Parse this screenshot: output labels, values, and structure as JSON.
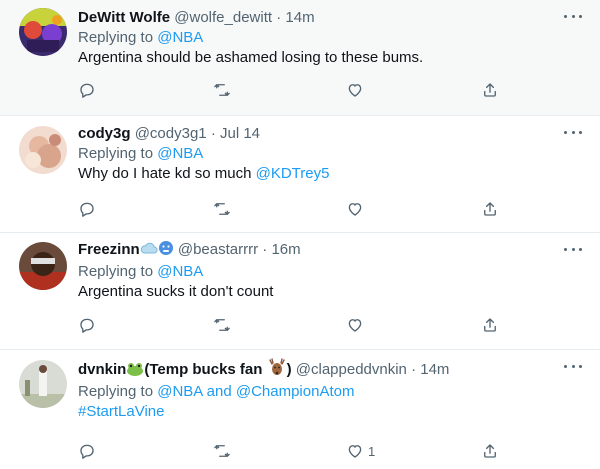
{
  "tweets": [
    {
      "name": "DeWitt Wolfe",
      "handle": "@wolfe_dewitt",
      "sep": "·",
      "time": "14m",
      "replying_prefix": "Replying to ",
      "replying_to": "@NBA",
      "text": "Argentina should be ashamed losing to these bums."
    },
    {
      "name": "cody3g",
      "handle": "@cody3g1",
      "sep": "·",
      "time": "Jul 14",
      "replying_prefix": "Replying to ",
      "replying_to": "@NBA",
      "text": "Why do I hate kd so much ",
      "mention": "@KDTrey5"
    },
    {
      "name": "Freezinn",
      "handle": "@beastarrrr",
      "sep": "·",
      "time": "16m",
      "replying_prefix": "Replying to ",
      "replying_to": "@NBA",
      "text": "Argentina sucks it don't count"
    },
    {
      "name": "dvnkin",
      "name_suffix": "(Temp bucks fan ",
      "name_close": ")",
      "handle": "@clappeddvnkin",
      "sep": "·",
      "time": "14m",
      "replying_prefix": "Replying to ",
      "replying_to": "@NBA",
      "replying_and": " and ",
      "replying_to_2": "@ChampionAtom",
      "hashtag": "#StartLaVine",
      "like_count": "1"
    }
  ],
  "colors": {
    "link": "#1d9bf0",
    "muted": "#536471",
    "border": "#e6ecf0",
    "highlight_bg": "#f7f9f9"
  },
  "icons": [
    "reply-icon",
    "retweet-icon",
    "like-icon",
    "share-icon",
    "more-icon"
  ]
}
